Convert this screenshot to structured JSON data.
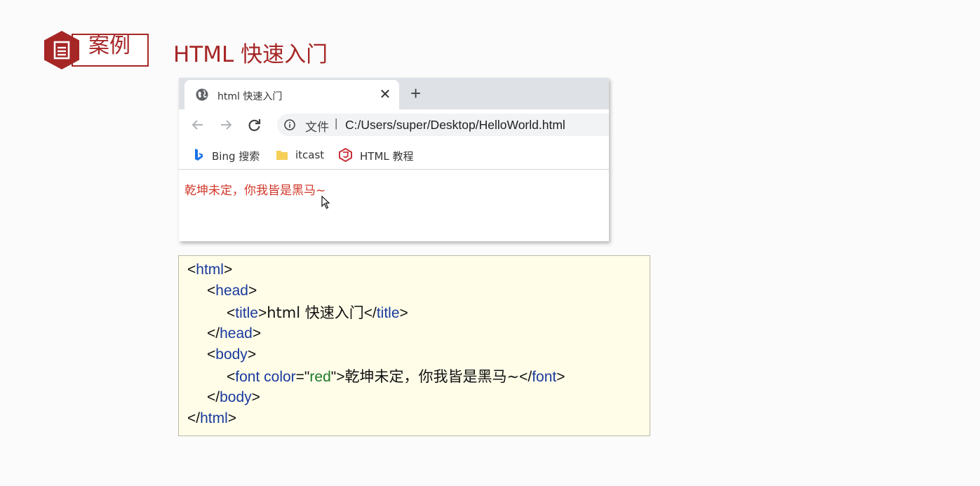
{
  "header": {
    "badge_label": "案例",
    "title": "HTML 快速入门",
    "accent_color": "#a62626",
    "badge_icon": "document-icon"
  },
  "browser": {
    "tab": {
      "title": "html 快速入门",
      "icon": "globe-icon",
      "close_glyph": "✕"
    },
    "new_tab_glyph": "+",
    "toolbar": {
      "back_icon": "arrow-left-icon",
      "forward_icon": "arrow-right-icon",
      "reload_icon": "reload-icon",
      "info_icon": "info-icon",
      "file_label": "文件",
      "separator": "|",
      "url": "C:/Users/super/Desktop/HelloWorld.html"
    },
    "bookmarks": [
      {
        "label": "Bing 搜索",
        "icon": "bing-icon"
      },
      {
        "label": "itcast",
        "icon": "folder-icon"
      },
      {
        "label": "HTML 教程",
        "icon": "html5-icon"
      }
    ],
    "page_text": "乾坤未定，你我皆是黑马~",
    "page_text_color": "#d2382a"
  },
  "code": {
    "lines": [
      [
        {
          "t": "<",
          "c": "p"
        },
        {
          "t": "html",
          "c": "tg"
        },
        {
          "t": ">",
          "c": "p"
        }
      ],
      [
        {
          "t": "<",
          "c": "p"
        },
        {
          "t": "head",
          "c": "tg"
        },
        {
          "t": ">",
          "c": "p"
        }
      ],
      [
        {
          "t": "<",
          "c": "p"
        },
        {
          "t": "title",
          "c": "tg"
        },
        {
          "t": ">",
          "c": "p"
        },
        {
          "t": "html 快速入门",
          "c": "tx"
        },
        {
          "t": "</",
          "c": "p"
        },
        {
          "t": "title",
          "c": "tg"
        },
        {
          "t": ">",
          "c": "p"
        }
      ],
      [
        {
          "t": "</",
          "c": "p"
        },
        {
          "t": "head",
          "c": "tg"
        },
        {
          "t": ">",
          "c": "p"
        }
      ],
      [
        {
          "t": "<",
          "c": "p"
        },
        {
          "t": "body",
          "c": "tg"
        },
        {
          "t": ">",
          "c": "p"
        }
      ],
      [
        {
          "t": "<",
          "c": "p"
        },
        {
          "t": "font ",
          "c": "tg"
        },
        {
          "t": "color",
          "c": "at"
        },
        {
          "t": "=\"",
          "c": "p"
        },
        {
          "t": "red",
          "c": "sv"
        },
        {
          "t": "\">",
          "c": "p"
        },
        {
          "t": "乾坤未定，你我皆是黑马~",
          "c": "tx"
        },
        {
          "t": "</",
          "c": "p"
        },
        {
          "t": "font",
          "c": "tg"
        },
        {
          "t": ">",
          "c": "p"
        }
      ],
      [
        {
          "t": "</",
          "c": "p"
        },
        {
          "t": "body",
          "c": "tg"
        },
        {
          "t": ">",
          "c": "p"
        }
      ],
      [
        {
          "t": "</",
          "c": "p"
        },
        {
          "t": "html",
          "c": "tg"
        },
        {
          "t": ">",
          "c": "p"
        }
      ]
    ]
  }
}
